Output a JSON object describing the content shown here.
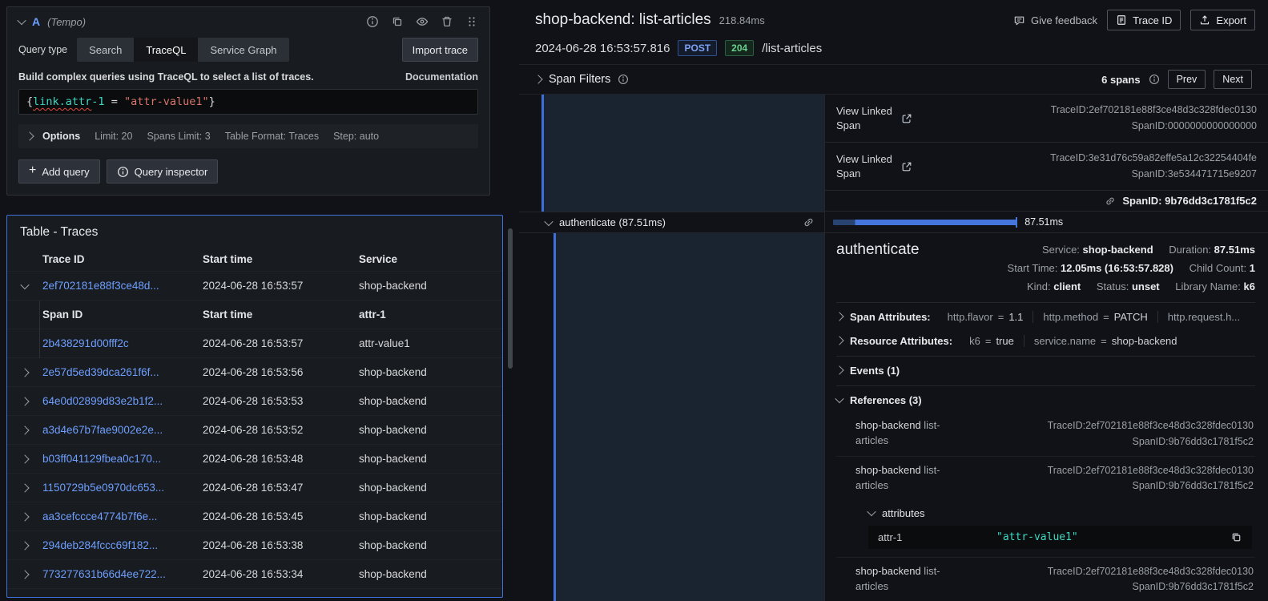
{
  "colors": {
    "accent_blue": "#3d71d9",
    "link_blue": "#6e9fff",
    "success_green": "#6ccf8e",
    "query_field_teal": "#3fd8c2",
    "query_string_red": "#d8756a"
  },
  "query_editor": {
    "ref_id": "A",
    "datasource": "(Tempo)",
    "query_type_label": "Query type",
    "tabs": [
      {
        "label": "Search"
      },
      {
        "label": "TraceQL"
      },
      {
        "label": "Service Graph"
      }
    ],
    "import_trace_button": "Import trace",
    "help_text": "Build complex queries using TraceQL to select a list of traces.",
    "documentation_link": "Documentation",
    "query_tokens": {
      "brace_open": "{",
      "field_main": "link.attr",
      "field_rest": "-1",
      "operator": " = ",
      "value": "\"attr-value1\"",
      "brace_close": "}"
    },
    "options_label": "Options",
    "options": [
      "Limit: 20",
      "Spans Limit: 3",
      "Table Format: Traces",
      "Step: auto"
    ],
    "add_query_button": "Add query",
    "query_inspector_button": "Query inspector"
  },
  "traces_table": {
    "title": "Table - Traces",
    "columns": {
      "trace_id": "Trace ID",
      "start_time": "Start time",
      "service": "Service"
    },
    "expanded_row": {
      "trace_id": "2ef702181e88f3ce48d...",
      "start_time": "2024-06-28 16:53:57",
      "service": "shop-backend"
    },
    "sub_columns": {
      "span_id": "Span ID",
      "start_time": "Start time",
      "attr": "attr-1"
    },
    "sub_row": {
      "span_id": "2b438291d00fff2c",
      "start_time": "2024-06-28 16:53:57",
      "attr": "attr-value1"
    },
    "rows": [
      {
        "trace_id": "2e57d5ed39dca261f6f...",
        "start_time": "2024-06-28 16:53:56",
        "service": "shop-backend"
      },
      {
        "trace_id": "64e0d02899d83e2b1f2...",
        "start_time": "2024-06-28 16:53:53",
        "service": "shop-backend"
      },
      {
        "trace_id": "a3d4e67b7fae9002e2e...",
        "start_time": "2024-06-28 16:53:52",
        "service": "shop-backend"
      },
      {
        "trace_id": "b03ff041129fbea0c170...",
        "start_time": "2024-06-28 16:53:48",
        "service": "shop-backend"
      },
      {
        "trace_id": "1150729b5e0970dc653...",
        "start_time": "2024-06-28 16:53:47",
        "service": "shop-backend"
      },
      {
        "trace_id": "aa3cefccce4774b7f6e...",
        "start_time": "2024-06-28 16:53:45",
        "service": "shop-backend"
      },
      {
        "trace_id": "294deb284fccc69f182...",
        "start_time": "2024-06-28 16:53:38",
        "service": "shop-backend"
      },
      {
        "trace_id": "773277631b66d4ee722...",
        "start_time": "2024-06-28 16:53:34",
        "service": "shop-backend"
      }
    ]
  },
  "trace_view": {
    "title": "shop-backend: list-articles",
    "total_duration": "218.84ms",
    "give_feedback": "Give feedback",
    "trace_id_button": "Trace ID",
    "export_button": "Export",
    "timestamp": "2024-06-28 16:53:57.816",
    "method_badge": "POST",
    "status_badge": "204",
    "path": "/list-articles",
    "span_filters_label": "Span Filters",
    "span_count": "6 spans",
    "prev_button": "Prev",
    "next_button": "Next",
    "linked_spans": [
      {
        "label": "View Linked Span",
        "trace_id": "TraceID:2ef702181e88f3ce48d3c328fdec0130",
        "span_id": "SpanID:0000000000000000"
      },
      {
        "label": "View Linked Span",
        "trace_id": "TraceID:3e31d76c59a82effe5a12c32254404fe",
        "span_id": "SpanID:3e534471715e9207"
      }
    ],
    "hovered_span_id": "SpanID: 9b76dd3c1781f5c2",
    "span_bar": {
      "label": "authenticate (87.51ms)",
      "duration": "87.51ms"
    },
    "detail": {
      "name": "authenticate",
      "service_label": "Service:",
      "service_value": "shop-backend",
      "duration_label": "Duration:",
      "duration_value": "87.51ms",
      "start_time_label": "Start Time:",
      "start_time_value": "12.05ms (16:53:57.828)",
      "child_count_label": "Child Count:",
      "child_count_value": "1",
      "kind_label": "Kind:",
      "kind_value": "client",
      "status_label": "Status:",
      "status_value": "unset",
      "library_label": "Library Name:",
      "library_value": "k6",
      "span_attributes_label": "Span Attributes:",
      "span_attributes": [
        {
          "key": "http.flavor",
          "eq": "=",
          "value": "1.1"
        },
        {
          "key": "http.method",
          "eq": "=",
          "value": "PATCH"
        },
        {
          "key": "http.request.h...",
          "eq": "",
          "value": ""
        }
      ],
      "resource_attributes_label": "Resource Attributes:",
      "resource_attributes": [
        {
          "key": "k6",
          "eq": "=",
          "value": "true"
        },
        {
          "key": "service.name",
          "eq": "=",
          "value": "shop-backend"
        }
      ],
      "events_label": "Events (1)",
      "references_label": "References (3)",
      "references": [
        {
          "service": "shop-backend",
          "span_name": "list-articles",
          "trace_id": "TraceID:2ef702181e88f3ce48d3c328fdec0130",
          "span_id": "SpanID:9b76dd3c1781f5c2"
        },
        {
          "service": "shop-backend",
          "span_name": "list-articles",
          "trace_id": "TraceID:2ef702181e88f3ce48d3c328fdec0130",
          "span_id": "SpanID:9b76dd3c1781f5c2"
        },
        {
          "service": "shop-backend",
          "span_name": "list-articles",
          "trace_id": "TraceID:2ef702181e88f3ce48d3c328fdec0130",
          "span_id": "SpanID:9b76dd3c1781f5c2"
        }
      ],
      "ref_attributes_label": "attributes",
      "ref_attribute": {
        "key": "attr-1",
        "value": "\"attr-value1\""
      }
    }
  }
}
